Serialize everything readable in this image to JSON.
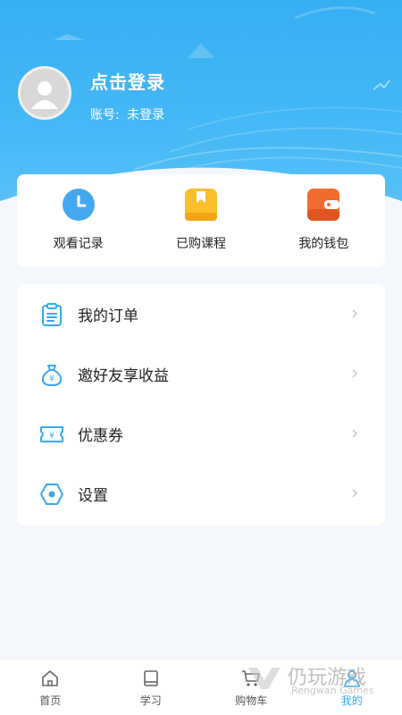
{
  "profile": {
    "login_title": "点击登录",
    "account_label": "账号:",
    "account_value": "未登录"
  },
  "quick_actions": [
    {
      "label": "观看记录",
      "icon": "clock-icon",
      "color": "#45a8ee"
    },
    {
      "label": "已购课程",
      "icon": "bookmark-book-icon",
      "color": "#fbbf2b"
    },
    {
      "label": "我的钱包",
      "icon": "wallet-icon",
      "color": "#f36b2f"
    }
  ],
  "menu": [
    {
      "label": "我的订单",
      "icon": "clipboard-icon"
    },
    {
      "label": "邀好友享收益",
      "icon": "money-bag-icon"
    },
    {
      "label": "优惠券",
      "icon": "coupon-icon"
    },
    {
      "label": "设置",
      "icon": "settings-hexagon-icon"
    }
  ],
  "bottom_nav": [
    {
      "label": "首页",
      "icon": "home-icon",
      "active": false
    },
    {
      "label": "学习",
      "icon": "book-icon",
      "active": false
    },
    {
      "label": "购物车",
      "icon": "cart-icon",
      "active": false
    },
    {
      "label": "我的",
      "icon": "user-icon",
      "active": true
    }
  ],
  "watermark": {
    "text": "仍玩游戏",
    "sub": "Rengwan Games"
  },
  "colors": {
    "header_blue": "#3fb3f4",
    "accent_blue": "#3aa9ee",
    "page_bg": "#f4f8fc"
  }
}
